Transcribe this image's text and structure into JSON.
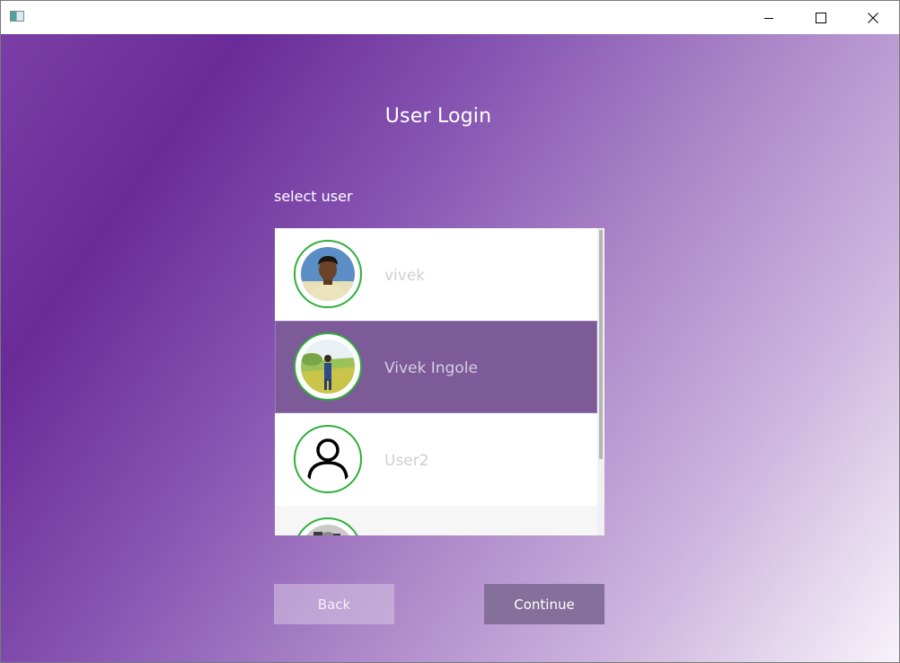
{
  "window": {
    "icons": {
      "app": "app-window-icon",
      "minimize": "minimize-icon",
      "maximize": "maximize-icon",
      "close": "close-icon"
    }
  },
  "login": {
    "title": "User Login",
    "subtitle": "select user",
    "users": [
      {
        "name": "vivek",
        "avatar": "user-photo-avatar",
        "selected": false
      },
      {
        "name": "Vivek Ingole",
        "avatar": "user-photo-avatar",
        "selected": true
      },
      {
        "name": "User2",
        "avatar": "person-outline-icon",
        "selected": false
      },
      {
        "name": "",
        "avatar": "user-photo-avatar",
        "selected": false
      }
    ],
    "back_label": "Back",
    "continue_label": "Continue"
  },
  "colors": {
    "accent_ring": "#2fae3c",
    "selected_row": "#7c5b98",
    "continue_button": "#84709a"
  }
}
